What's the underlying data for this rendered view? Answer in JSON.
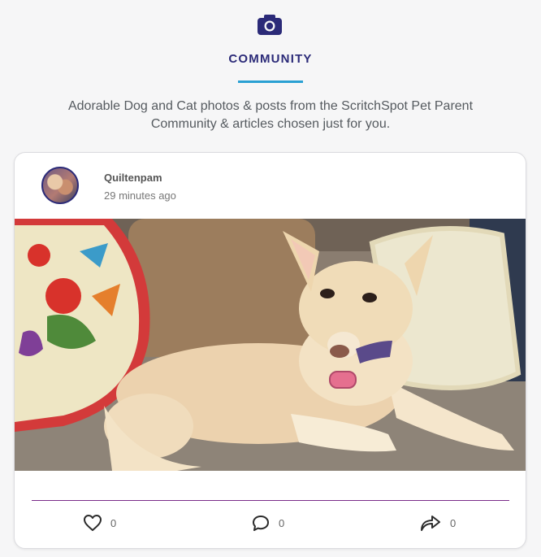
{
  "header": {
    "icon": "camera-icon",
    "title": "COMMUNITY",
    "accent_color": "#2aa0d3",
    "title_color": "#2b2a78",
    "description": "Adorable Dog and Cat photos & posts from the ScritchSpot Pet Parent Community & articles chosen just for you."
  },
  "post": {
    "author": "Quiltenpam",
    "time": "29 minutes ago",
    "avatar_icon": "avatar",
    "image": "photo of a cream-colored dog lying on a couch with pillows",
    "actions": {
      "like": {
        "icon": "heart-icon",
        "count": "0"
      },
      "comment": {
        "icon": "comment-icon",
        "count": "0"
      },
      "share": {
        "icon": "share-icon",
        "count": "0"
      }
    }
  }
}
